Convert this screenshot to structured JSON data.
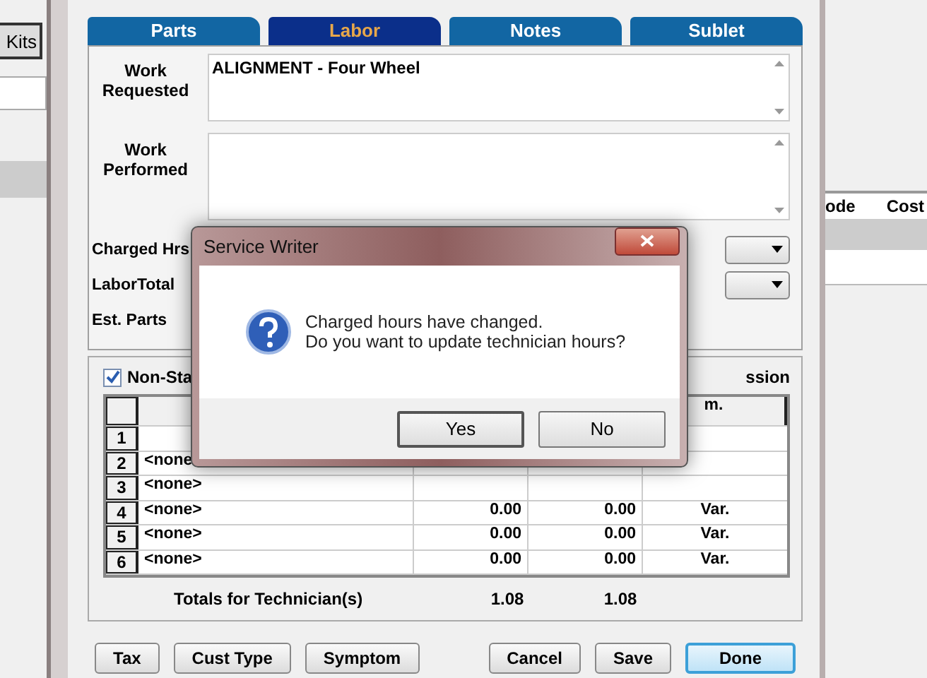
{
  "left_window": {
    "kits_button": "Kits"
  },
  "right_window": {
    "columns": [
      "ode",
      "Cost"
    ]
  },
  "tabs": [
    {
      "label": "Parts",
      "selected": false
    },
    {
      "label": "Labor",
      "selected": true
    },
    {
      "label": "Notes",
      "selected": false
    },
    {
      "label": "Sublet",
      "selected": false
    }
  ],
  "work_requested": {
    "label": "Work Requested",
    "value": "ALIGNMENT - Four Wheel"
  },
  "work_performed": {
    "label": "Work Performed"
  },
  "fields": [
    {
      "label": "Charged Hrs",
      "dropdown": true
    },
    {
      "label": "LaborTotal",
      "dropdown": true
    },
    {
      "label": "Est. Parts",
      "dropdown": false
    }
  ],
  "non_standard": {
    "label": "Non-Sta",
    "checked": true,
    "trailing_label": "ssion"
  },
  "table": {
    "header_last": "m.",
    "rows": [
      {
        "num": "1",
        "tech": "",
        "hrs": "",
        "col_3": "",
        "col_4": ""
      },
      {
        "num": "2",
        "tech": "<none",
        "hrs": "",
        "col_3": "",
        "col_4": ""
      },
      {
        "num": "3",
        "tech": "<none>",
        "hrs": "",
        "col_3": "",
        "col_4": ""
      },
      {
        "num": "4",
        "tech": "<none>",
        "hrs": "0.00",
        "col_3": "0.00",
        "col_4": "Var."
      },
      {
        "num": "5",
        "tech": "<none>",
        "hrs": "0.00",
        "col_3": "0.00",
        "col_4": "Var."
      },
      {
        "num": "6",
        "tech": "<none>",
        "hrs": "0.00",
        "col_3": "0.00",
        "col_4": "Var."
      }
    ],
    "totals_label": "Totals for Technician(s)",
    "totals": [
      "1.08",
      "1.08"
    ]
  },
  "buttons_left": [
    "Tax",
    "Cust Type",
    "Symptom"
  ],
  "buttons_right": [
    {
      "label": "Cancel",
      "default": false
    },
    {
      "label": "Save",
      "default": false
    },
    {
      "label": "Done",
      "default": true
    }
  ],
  "dialog": {
    "title": "Service Writer",
    "message_lines": [
      "Charged hours have changed.",
      "Do you want to update technician hours?"
    ],
    "buttons": [
      {
        "label": "Yes",
        "default": true
      },
      {
        "label": "No",
        "default": false
      }
    ]
  }
}
